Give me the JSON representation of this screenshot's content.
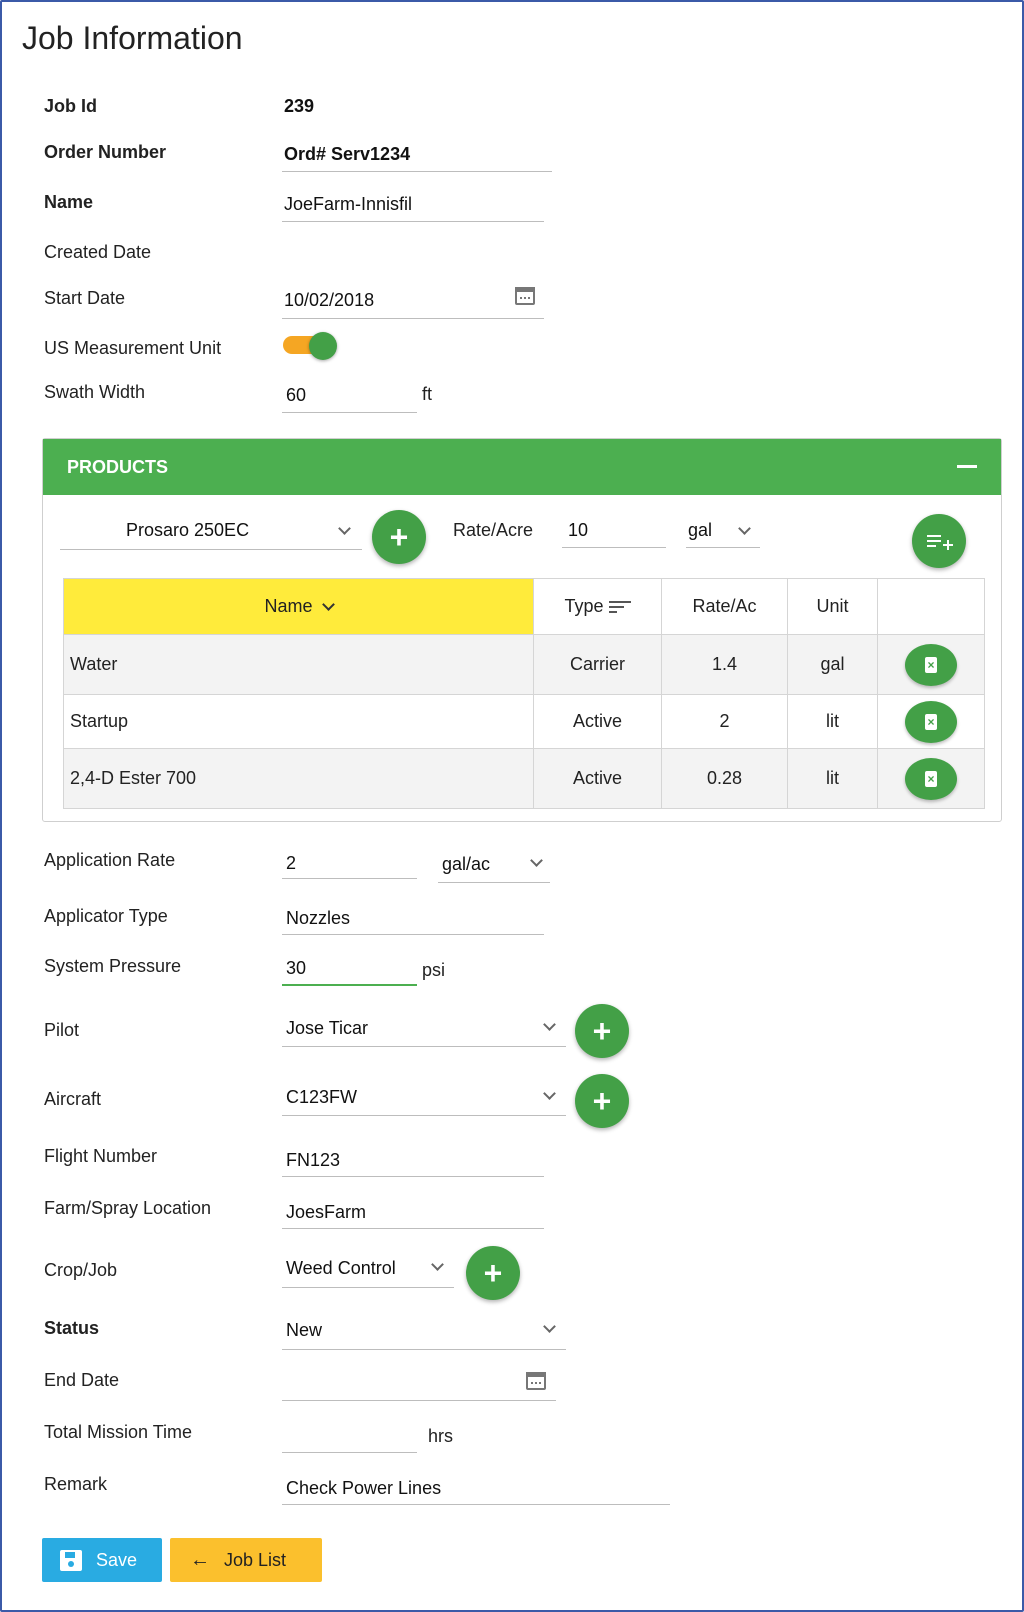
{
  "title": "Job Information",
  "fields": {
    "job_id": {
      "label": "Job Id",
      "value": "239"
    },
    "order_number": {
      "label": "Order Number",
      "value": "Ord# Serv1234"
    },
    "name": {
      "label": "Name",
      "value": "JoeFarm-Innisfil"
    },
    "created_date": {
      "label": "Created Date",
      "value": ""
    },
    "start_date": {
      "label": "Start Date",
      "value": "10/02/2018"
    },
    "us_unit": {
      "label": "US Measurement Unit",
      "enabled": true
    },
    "swath_width": {
      "label": "Swath Width",
      "value": "60",
      "unit": "ft"
    },
    "application_rate": {
      "label": "Application Rate",
      "value": "2",
      "unit": "gal/ac"
    },
    "applicator_type": {
      "label": "Applicator Type",
      "value": "Nozzles"
    },
    "system_pressure": {
      "label": "System Pressure",
      "value": "30",
      "unit": "psi"
    },
    "pilot": {
      "label": "Pilot",
      "value": "Jose Ticar"
    },
    "aircraft": {
      "label": "Aircraft",
      "value": "C123FW"
    },
    "flight_number": {
      "label": "Flight Number",
      "value": "FN123"
    },
    "farm_location": {
      "label": "Farm/Spray Location",
      "value": "JoesFarm"
    },
    "crop_job": {
      "label": "Crop/Job",
      "value": "Weed Control"
    },
    "status": {
      "label": "Status",
      "value": "New"
    },
    "end_date": {
      "label": "End Date",
      "value": ""
    },
    "total_mission_time": {
      "label": "Total Mission Time",
      "value": "",
      "unit": "hrs"
    },
    "remark": {
      "label": "Remark",
      "value": "Check Power Lines"
    }
  },
  "products": {
    "title": "PRODUCTS",
    "selected_product": "Prosaro 250EC",
    "rate_label": "Rate/Acre",
    "rate_value": "10",
    "rate_unit": "gal",
    "columns": [
      "Name",
      "Type",
      "Rate/Ac",
      "Unit"
    ],
    "rows": [
      {
        "name": "Water",
        "type": "Carrier",
        "rate": "1.4",
        "unit": "gal"
      },
      {
        "name": "Startup",
        "type": "Active",
        "rate": "2",
        "unit": "lit"
      },
      {
        "name": "2,4-D Ester 700",
        "type": "Active",
        "rate": "0.28",
        "unit": "lit"
      }
    ]
  },
  "buttons": {
    "save": "Save",
    "job_list": "Job List"
  },
  "colors": {
    "accent_green": "#43a047",
    "panel_green": "#4caf50",
    "header_yellow": "#ffeb3b",
    "save_blue": "#29abe2",
    "job_list_amber": "#fbc02d",
    "toggle_track": "#f5a623"
  }
}
